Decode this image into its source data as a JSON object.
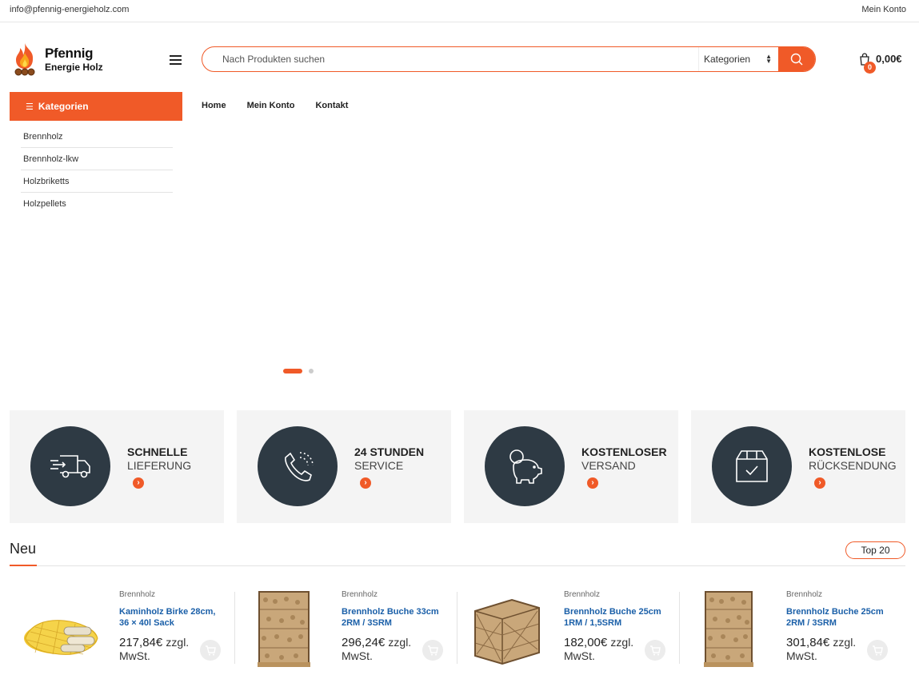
{
  "topbar": {
    "email": "info@pfennig-energieholz.com",
    "account": "Mein Konto"
  },
  "logo": {
    "line1": "Pfennig",
    "line2": "Energie Holz"
  },
  "search": {
    "placeholder": "Nach Produkten suchen",
    "category": "Kategorien"
  },
  "cart": {
    "count": "0",
    "total": "0,00€"
  },
  "categories": {
    "button": "Kategorien",
    "items": [
      {
        "label": "Brennholz"
      },
      {
        "label": "Brennholz-lkw"
      },
      {
        "label": "Holzbriketts"
      },
      {
        "label": "Holzpellets"
      }
    ]
  },
  "nav": [
    {
      "label": "Home"
    },
    {
      "label": "Mein Konto"
    },
    {
      "label": "Kontakt"
    }
  ],
  "features": [
    {
      "line1": "SCHNELLE",
      "line2": "LIEFERUNG",
      "icon": "truck-icon"
    },
    {
      "line1": "24 STUNDEN",
      "line2": "SERVICE",
      "icon": "phone-icon"
    },
    {
      "line1": "KOSTENLOSER",
      "line2": "VERSAND",
      "icon": "piggy-bank-icon"
    },
    {
      "line1": "KOSTENLOSE",
      "line2": "RÜCKSENDUNG",
      "icon": "box-icon"
    }
  ],
  "section": {
    "title": "Neu",
    "button": "Top 20"
  },
  "products": [
    {
      "category": "Brennholz",
      "name": "Kaminholz Birke 28cm, 36 × 40l Sack",
      "price": "217,84€",
      "tax": "zzgl. MwSt."
    },
    {
      "category": "Brennholz",
      "name": "Brennholz Buche 33cm 2RM / 3SRM",
      "price": "296,24€",
      "tax": "zzgl. MwSt."
    },
    {
      "category": "Brennholz",
      "name": "Brennholz Buche 25cm 1RM / 1,5SRM",
      "price": "182,00€",
      "tax": "zzgl. MwSt."
    },
    {
      "category": "Brennholz",
      "name": "Brennholz Buche 25cm 2RM / 3SRM",
      "price": "301,84€",
      "tax": "zzgl. MwSt."
    }
  ],
  "colors": {
    "accent": "#f05a28",
    "dark": "#2e3a44",
    "link": "#1a5fa8"
  }
}
